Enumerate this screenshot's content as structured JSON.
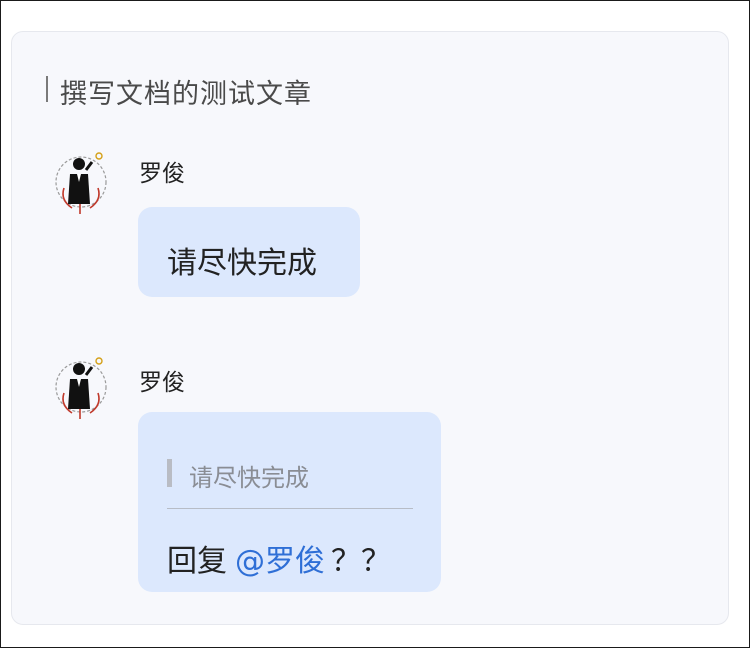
{
  "doc": {
    "title": "撰写文档的测试文章"
  },
  "messages": [
    {
      "sender": "罗俊",
      "avatar_icon": "man-in-suit-avatar-icon",
      "text": "请尽快完成"
    },
    {
      "sender": "罗俊",
      "avatar_icon": "man-in-suit-avatar-icon",
      "quote": "请尽快完成",
      "reply_prefix": "回复",
      "mention": "@罗俊",
      "reply_suffix": "？？"
    }
  ],
  "colors": {
    "bubble": "#dce8fd",
    "mention": "#2f6fd6",
    "card_bg": "#f7f8fc"
  }
}
